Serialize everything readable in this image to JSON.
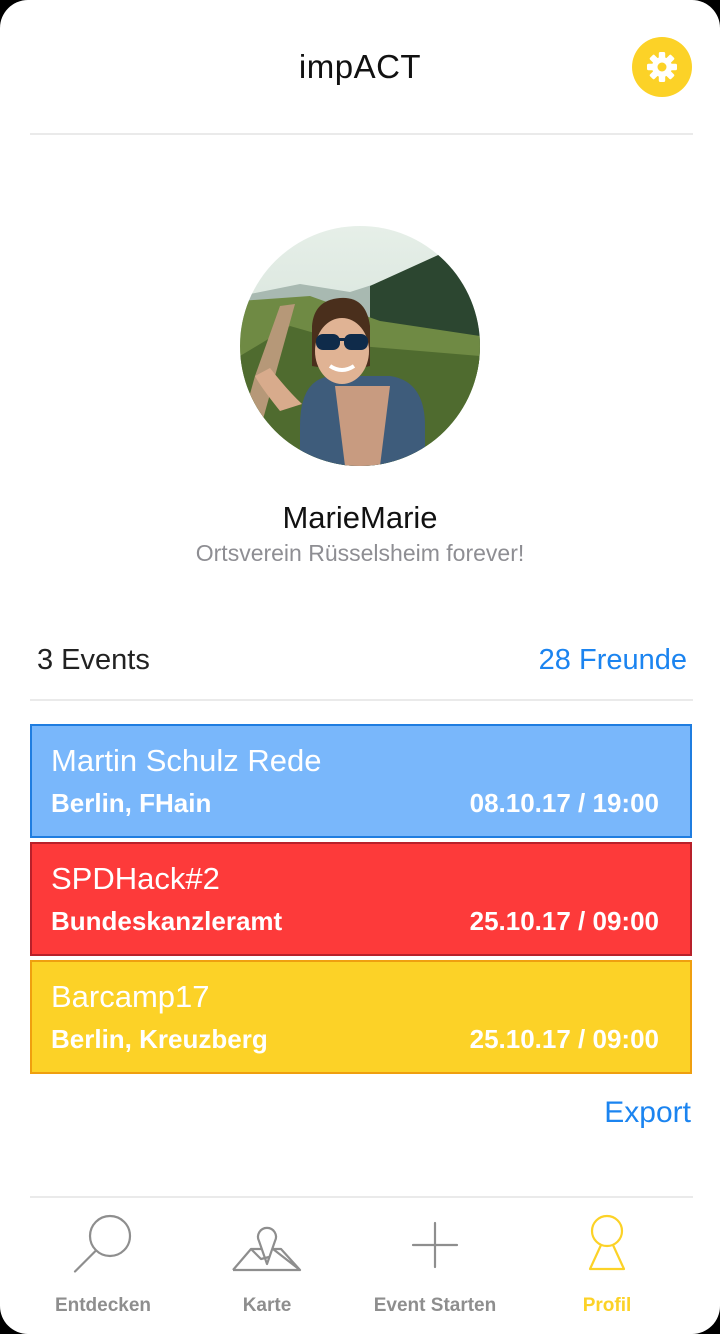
{
  "header": {
    "title": "impACT",
    "settings_icon": "gear-icon"
  },
  "profile": {
    "name": "MarieMarie",
    "bio": "Ortsverein Rüsselsheim forever!"
  },
  "stats": {
    "events": "3 Events",
    "friends": "28 Freunde"
  },
  "events": [
    {
      "title": "Martin Schulz Rede",
      "location": "Berlin, FHain",
      "datetime": "08.10.17 / 19:00",
      "color": "#79b7fb",
      "border": "#1f7de0"
    },
    {
      "title": "SPDHack#2",
      "location": "Bundeskanzleramt",
      "datetime": "25.10.17 / 09:00",
      "color": "#fd3a3a",
      "border": "#b8202a"
    },
    {
      "title": "Barcamp17",
      "location": "Berlin, Kreuzberg",
      "datetime": "25.10.17 / 09:00",
      "color": "#fcd227",
      "border": "#ef9f0f"
    }
  ],
  "export_label": "Export",
  "tabs": [
    {
      "label": "Entdecken",
      "icon": "search-icon",
      "active": false
    },
    {
      "label": "Karte",
      "icon": "map-icon",
      "active": false
    },
    {
      "label": "Event Starten",
      "icon": "plus-icon",
      "active": false
    },
    {
      "label": "Profil",
      "icon": "profile-icon",
      "active": true
    }
  ],
  "colors": {
    "accent": "#fcd227",
    "link": "#1b84f0",
    "inactive": "#8e8e8e"
  }
}
